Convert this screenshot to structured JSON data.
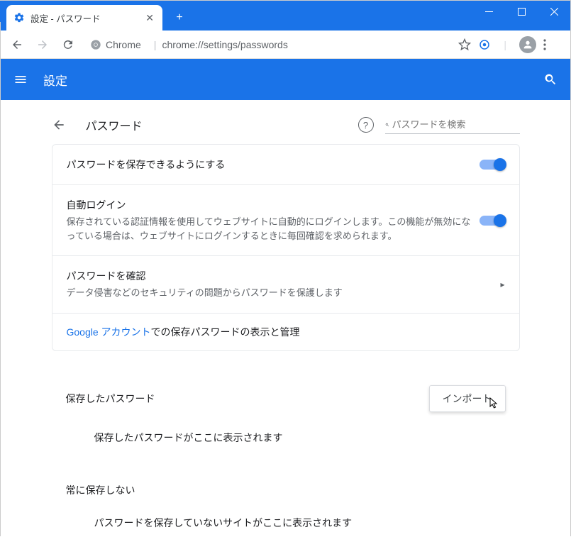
{
  "window": {
    "tab_title": "設定 - パスワード",
    "url_scheme": "Chrome",
    "url_path": "chrome://settings/passwords"
  },
  "header": {
    "title": "設定"
  },
  "page": {
    "title": "パスワード",
    "search_placeholder": "パスワードを検索"
  },
  "rows": {
    "offer_save": {
      "label": "パスワードを保存できるようにする"
    },
    "auto_signin": {
      "label": "自動ログイン",
      "sub": "保存されている認証情報を使用してウェブサイトに自動的にログインします。この機能が無効になっている場合は、ウェブサイトにログインするときに毎回確認を求められます。"
    },
    "check": {
      "label": "パスワードを確認",
      "sub": "データ侵害などのセキュリティの問題からパスワードを保護します"
    },
    "google_link": {
      "link_text": "Google アカウント",
      "suffix": "での保存パスワードの表示と管理"
    },
    "saved": {
      "label": "保存したパスワード",
      "empty": "保存したパスワードがここに表示されます",
      "import_btn": "インポート"
    },
    "never": {
      "label": "常に保存しない",
      "empty": "パスワードを保存していないサイトがここに表示されます"
    }
  }
}
